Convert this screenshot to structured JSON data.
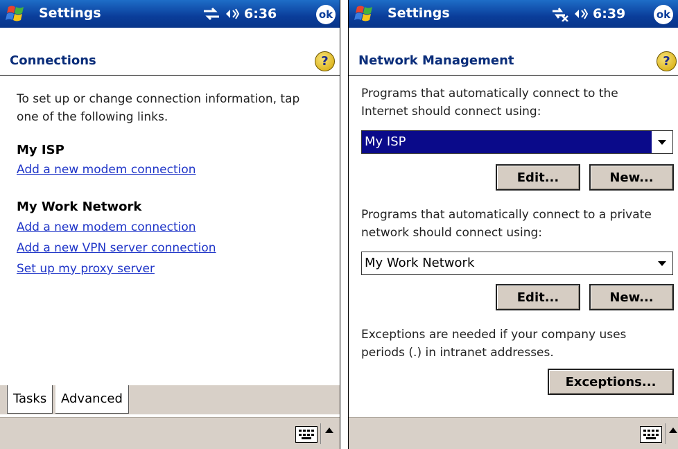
{
  "left": {
    "app_title": "Settings",
    "time": "6:36",
    "ok_label": "ok",
    "header_title": "Connections",
    "help_label": "?",
    "intro_text": "To set up or change connection information, tap one of the following links.",
    "groups": [
      {
        "title": "My ISP",
        "links": [
          "Add a new modem connection"
        ]
      },
      {
        "title": "My Work Network",
        "links": [
          "Add a new modem connection",
          "Add a new VPN server connection",
          "Set up my proxy server"
        ]
      }
    ],
    "tabs": [
      "Tasks",
      "Advanced"
    ]
  },
  "right": {
    "app_title": "Settings",
    "time": "6:39",
    "ok_label": "ok",
    "header_title": "Network Management",
    "help_label": "?",
    "internet_text": "Programs that automatically connect to the Internet should connect using:",
    "internet_selected": "My ISP",
    "private_text": "Programs that automatically connect to a private network should connect using:",
    "private_selected": "My Work Network",
    "edit_label": "Edit...",
    "new_label": "New...",
    "exceptions_text": "Exceptions are needed if your company uses periods (.) in intranet addresses.",
    "exceptions_button": "Exceptions..."
  },
  "colors": {
    "title_bar": "#0a3d9a",
    "header_text": "#0a2d7a",
    "link": "#1f35c8",
    "selection": "#0a0a8a",
    "chrome": "#d8d0c8"
  }
}
